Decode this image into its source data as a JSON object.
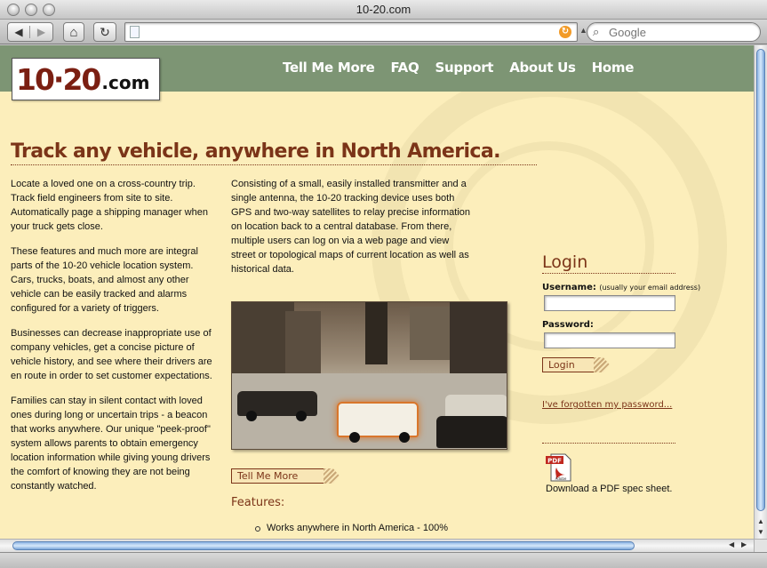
{
  "window": {
    "title": "10-20.com"
  },
  "browser": {
    "back_glyph": "◀",
    "forward_glyph": "▶",
    "home_glyph": "⌂",
    "reload_glyph": "↻",
    "address_value": "",
    "search_placeholder": "Google",
    "rss_glyph": "↻"
  },
  "site": {
    "logo_num": "10·20",
    "logo_domain": ".com",
    "nav": [
      {
        "label": "Tell Me More"
      },
      {
        "label": "FAQ"
      },
      {
        "label": "Support"
      },
      {
        "label": "About Us"
      },
      {
        "label": "Home"
      }
    ],
    "headline": "Track any vehicle, anywhere in North America.",
    "left_paragraphs": [
      "Locate a loved one on a cross-country trip. Track field engineers from site to site. Automatically page a shipping manager when your truck gets close.",
      "These features and much more are integral parts of the 10-20 vehicle location system. Cars, trucks, boats, and almost any other vehicle can be easily tracked and alarms configured for a variety of triggers.",
      "Businesses can decrease inappropriate use of company vehicles, get a concise picture of vehicle history, and see where their drivers are en route in order to set customer expectations.",
      "Families can stay in silent contact with loved ones during long or uncertain trips - a beacon that works anywhere. Our unique \"peek-proof\" system allows parents to obtain emergency location information while giving young drivers the comfort of knowing they are not being constantly watched."
    ],
    "mid_paragraph": "Consisting of a small, easily installed transmitter and a single antenna, the 10-20 tracking device uses both GPS and two-way satellites to relay precise information on location back to a central database. From there, multiple users can log on via a web page and view street or topological maps of current location as well as historical data.",
    "tell_me_more_button": "Tell Me More",
    "features_heading": "Features:",
    "features": [
      "Works anywhere in North America - 100%"
    ],
    "login": {
      "heading": "Login",
      "username_label": "Username:",
      "username_hint": "(usually your email address)",
      "username_value": "",
      "password_label": "Password:",
      "password_value": "",
      "button": "Login",
      "forgot": "I've forgotten my password...",
      "pdf_icon_text": "PDF",
      "pdf_icon_sub": "Adobe",
      "pdf_link": "Download a PDF spec sheet."
    }
  },
  "colors": {
    "page_bg": "#fceebb",
    "header_bg": "#7d9574",
    "accent": "#7b3418"
  }
}
